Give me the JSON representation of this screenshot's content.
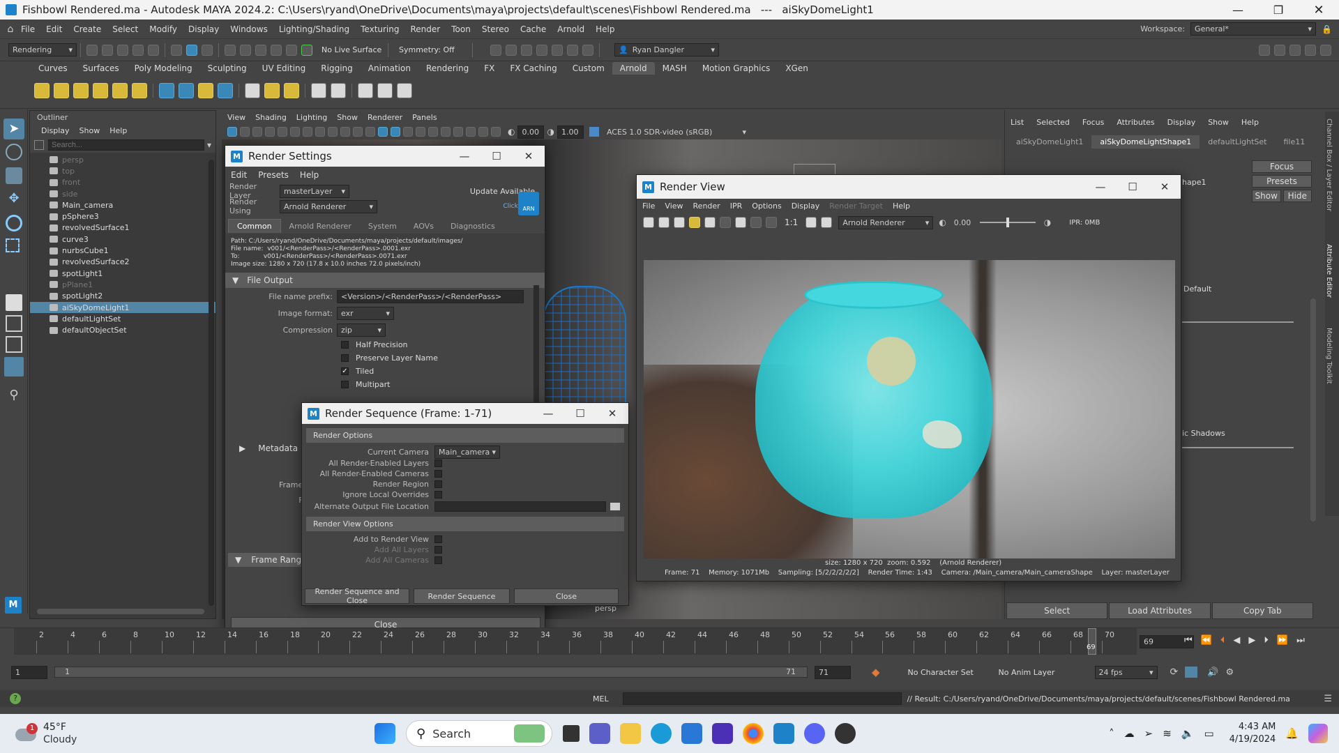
{
  "title_bar": {
    "text": "Fishbowl Rendered.ma - Autodesk MAYA 2024.2: C:\\Users\\ryand\\OneDrive\\Documents\\maya\\projects\\default\\scenes\\Fishbowl Rendered.ma   ---   aiSkyDomeLight1"
  },
  "main_menu": [
    "File",
    "Edit",
    "Create",
    "Select",
    "Modify",
    "Display",
    "Windows",
    "Lighting/Shading",
    "Texturing",
    "Render",
    "Toon",
    "Stereo",
    "Cache",
    "Arnold",
    "Help"
  ],
  "workspace": {
    "label": "Workspace:",
    "value": "General*"
  },
  "status_line": {
    "menu_set": "Rendering",
    "live_surface": "No Live Surface",
    "symmetry": "Symmetry: Off",
    "user": "Ryan Dangler"
  },
  "shelf_tabs": [
    "Curves",
    "Surfaces",
    "Poly Modeling",
    "Sculpting",
    "UV Editing",
    "Rigging",
    "Animation",
    "Rendering",
    "FX",
    "FX Caching",
    "Custom",
    "Arnold",
    "MASH",
    "Motion Graphics",
    "XGen"
  ],
  "shelf_active": "Arnold",
  "outliner": {
    "title": "Outliner",
    "menu": [
      "Display",
      "Show",
      "Help"
    ],
    "search_placeholder": "Search...",
    "items": [
      {
        "name": "persp",
        "dim": true
      },
      {
        "name": "top",
        "dim": true
      },
      {
        "name": "front",
        "dim": true
      },
      {
        "name": "side",
        "dim": true
      },
      {
        "name": "Main_camera",
        "dim": false
      },
      {
        "name": "pSphere3",
        "dim": false
      },
      {
        "name": "revolvedSurface1",
        "dim": false
      },
      {
        "name": "curve3",
        "dim": false
      },
      {
        "name": "nurbsCube1",
        "dim": false
      },
      {
        "name": "revolvedSurface2",
        "dim": false
      },
      {
        "name": "spotLight1",
        "dim": false
      },
      {
        "name": "pPlane1",
        "dim": true
      },
      {
        "name": "spotLight2",
        "dim": false
      },
      {
        "name": "aiSkyDomeLight1",
        "dim": false,
        "selected": true
      },
      {
        "name": "defaultLightSet",
        "dim": false
      },
      {
        "name": "defaultObjectSet",
        "dim": false
      }
    ]
  },
  "viewport": {
    "menu": [
      "View",
      "Shading",
      "Lighting",
      "Show",
      "Renderer",
      "Panels"
    ],
    "exposure": "0.00",
    "gamma": "1.00",
    "color_space": "ACES 1.0 SDR-video (sRGB)",
    "camera_label": "persp"
  },
  "render_settings": {
    "title": "Render Settings",
    "menu": [
      "Edit",
      "Presets",
      "Help"
    ],
    "render_layer_label": "Render Layer",
    "render_layer": "masterLayer",
    "render_using_label": "Render Using",
    "render_using": "Arnold Renderer",
    "update_text": "Update Available",
    "click_here": "Click Here",
    "arn_badge": "ARN",
    "tabs": [
      "Common",
      "Arnold Renderer",
      "System",
      "AOVs",
      "Diagnostics"
    ],
    "path_lines": [
      "Path: C:/Users/ryand/OneDrive/Documents/maya/projects/default/images/",
      "File name:  v001/<RenderPass>/<RenderPass>.0001.exr",
      "To:            v001/<RenderPass>/<RenderPass>.0071.exr",
      "Image size: 1280 x 720 (17.8 x 10.0 inches 72.0 pixels/inch)"
    ],
    "file_output_header": "File Output",
    "file_name_prefix_label": "File name prefix:",
    "file_name_prefix": "<Version>/<RenderPass>/<RenderPass>",
    "image_format_label": "Image format:",
    "image_format": "exr",
    "compression_label": "Compression",
    "compression": "zip",
    "checks": [
      {
        "label": "Half Precision",
        "checked": false
      },
      {
        "label": "Preserve Layer Name",
        "checked": false
      },
      {
        "label": "Tiled",
        "checked": true
      },
      {
        "label": "Multipart",
        "checked": false
      }
    ],
    "metadata_header": "Metadata",
    "frame_range_header": "Frame Range",
    "partial_labels": [
      "Col",
      "Frame/Anima",
      "Frame p",
      "E",
      "Versi",
      "Sta",
      "Er"
    ],
    "close": "Close"
  },
  "render_sequence": {
    "title": "Render Sequence (Frame: 1-71)",
    "render_options": "Render Options",
    "current_camera_label": "Current Camera",
    "current_camera": "Main_camera",
    "options": [
      "All Render-Enabled Layers",
      "All Render-Enabled Cameras",
      "Render Region",
      "Ignore Local Overrides"
    ],
    "alt_output_label": "Alternate Output File Location",
    "render_view_options": "Render View Options",
    "view_options": [
      {
        "label": "Add to Render View",
        "dim": false
      },
      {
        "label": "Add All Layers",
        "dim": true
      },
      {
        "label": "Add All Cameras",
        "dim": true
      }
    ],
    "btn_render_close": "Render Sequence and Close",
    "btn_render": "Render Sequence",
    "btn_close": "Close"
  },
  "render_view": {
    "title": "Render View",
    "menu": [
      "File",
      "View",
      "Render",
      "IPR",
      "Options",
      "Display",
      "Render Target",
      "Help"
    ],
    "ratio": "1:1",
    "renderer": "Arnold Renderer",
    "exposure": "0.00",
    "ipr": "IPR: 0MB",
    "size_text": "size: 1280 x 720  zoom: 0.592    (Arnold Renderer)",
    "info_text": "Frame: 71    Memory: 1071Mb    Sampling: [5/2/2/2/2/2]    Render Time: 1:43    Camera: /Main_camera/Main_cameraShape    Layer: masterLayer"
  },
  "attr_editor": {
    "menu": [
      "List",
      "Selected",
      "Focus",
      "Attributes",
      "Display",
      "Show",
      "Help"
    ],
    "tabs": [
      "aiSkyDomeLight1",
      "aiSkyDomeLightShape1",
      "defaultLightSet",
      "file11"
    ],
    "active_tab": "aiSkyDomeLightShape1",
    "side_buttons": [
      "Focus",
      "Presets",
      "Show",
      "Hide"
    ],
    "shape_text": "hape1",
    "default_text": "Default",
    "shadows_text": "ic Shadows",
    "bottom_buttons": [
      "Select",
      "Load Attributes",
      "Copy Tab"
    ],
    "side_tabs": [
      "Channel Box / Layer Editor",
      "Attribute Editor",
      "Modeling Toolkit"
    ]
  },
  "timeline": {
    "ticks": [
      "2",
      "4",
      "6",
      "8",
      "10",
      "12",
      "14",
      "16",
      "18",
      "20",
      "22",
      "24",
      "26",
      "28",
      "30",
      "32",
      "34",
      "36",
      "38",
      "40",
      "42",
      "44",
      "46",
      "48",
      "50",
      "52",
      "54",
      "56",
      "58",
      "60",
      "62",
      "64",
      "66",
      "68",
      "70"
    ],
    "current_frame": "69",
    "marker": "69"
  },
  "range": {
    "start": "1",
    "start2": "1",
    "end": "71",
    "end2": "71",
    "character_set": "No Character Set",
    "anim_layer": "No Anim Layer",
    "fps": "24 fps"
  },
  "command_line": {
    "lang": "MEL",
    "result": "// Result: C:/Users/ryand/OneDrive/Documents/maya/projects/default/scenes/Fishbowl Rendered.ma"
  },
  "taskbar": {
    "weather_temp": "45°F",
    "weather_desc": "Cloudy",
    "weather_badge": "1",
    "search": "Search",
    "time": "4:43 AM",
    "date": "4/19/2024"
  },
  "colors": {
    "accent": "#1e82c8",
    "selection": "#5285a6",
    "bowl": "#3fd6dc",
    "maya_dark": "#444444"
  }
}
